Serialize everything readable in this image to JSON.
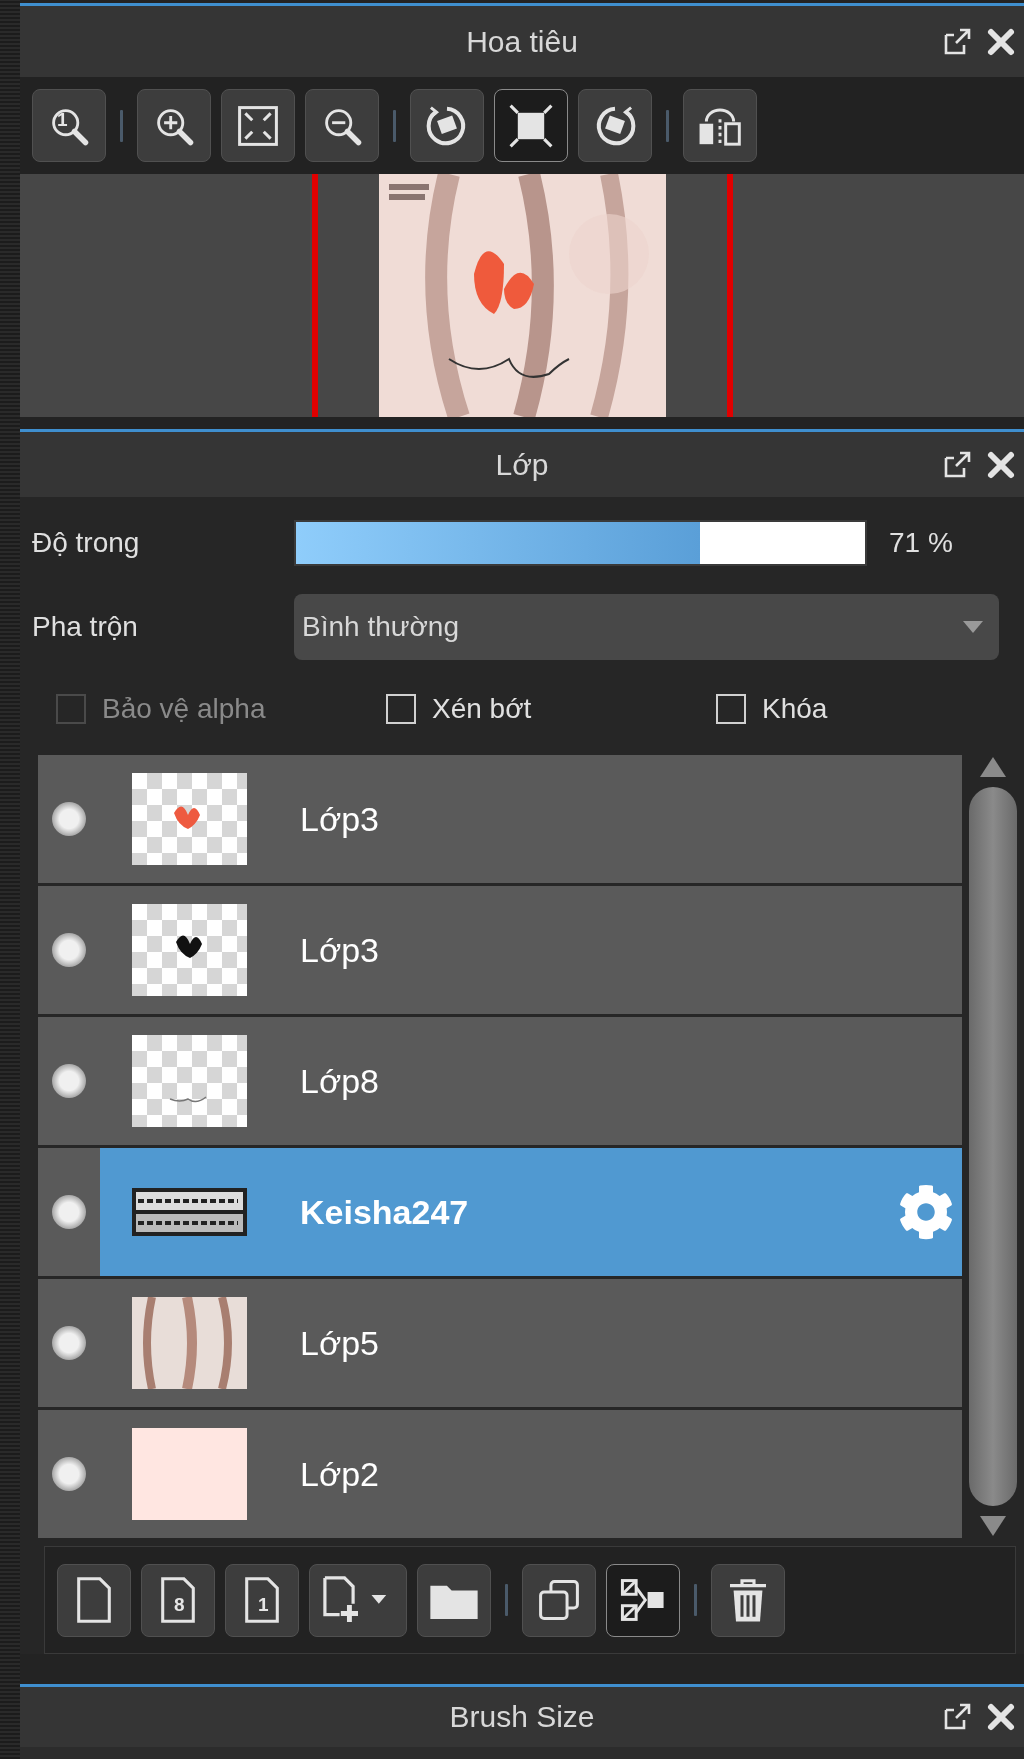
{
  "navigator": {
    "title": "Hoa tiêu",
    "tools": [
      {
        "kind": "zoom-actual",
        "glyph": "1",
        "active": false
      },
      {
        "kind": "separator"
      },
      {
        "kind": "zoom-in",
        "active": false
      },
      {
        "kind": "fit-canvas",
        "active": false
      },
      {
        "kind": "zoom-out",
        "active": false
      },
      {
        "kind": "separator"
      },
      {
        "kind": "rotate-left",
        "active": false
      },
      {
        "kind": "fit-window",
        "active": true
      },
      {
        "kind": "rotate-right",
        "active": false
      },
      {
        "kind": "separator"
      },
      {
        "kind": "flip",
        "active": false
      }
    ]
  },
  "layers_panel": {
    "title": "Lớp",
    "opacity": {
      "label": "Độ trong",
      "level": 0.71,
      "reading": "71 %"
    },
    "blend": {
      "label": "Pha trộn",
      "value": "Bình thường"
    },
    "options": [
      {
        "label": "Bảo vệ alpha",
        "checked": false,
        "disabled": true
      },
      {
        "label": "Xén bớt",
        "checked": false,
        "disabled": false
      },
      {
        "label": "Khóa",
        "checked": false,
        "disabled": false
      }
    ],
    "layers": [
      {
        "name": "Lớp3",
        "selected": false
      },
      {
        "name": "Lớp3",
        "selected": false
      },
      {
        "name": "Lớp8",
        "selected": false
      },
      {
        "name": "Keisha247",
        "selected": true
      },
      {
        "name": "Lớp5",
        "selected": false
      },
      {
        "name": "Lớp2",
        "selected": false
      }
    ],
    "tools": [
      {
        "kind": "new-layer",
        "active": false
      },
      {
        "kind": "page",
        "glyph": "8",
        "active": false
      },
      {
        "kind": "page",
        "glyph": "1",
        "active": false
      },
      {
        "kind": "add-menu",
        "active": false
      },
      {
        "kind": "folder",
        "active": false
      },
      {
        "kind": "separator"
      },
      {
        "kind": "duplicate",
        "active": false
      },
      {
        "kind": "merge",
        "active": true
      },
      {
        "kind": "separator"
      },
      {
        "kind": "delete",
        "active": false
      }
    ]
  },
  "brush_size": {
    "title": "Brush Size"
  }
}
